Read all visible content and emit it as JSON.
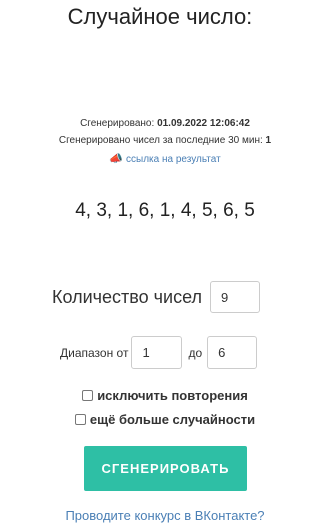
{
  "title": "Случайное число:",
  "meta": {
    "generated_label": "Сгенерировано:",
    "generated_value": "01.09.2022 12:06:42",
    "count_label": "Сгенерировано чисел за последние 30 мин:",
    "count_value": "1",
    "link_icon": "share-link-icon",
    "link_text": "ссылка на результат"
  },
  "result": "4, 3, 1, 6, 1, 4, 5, 6, 5",
  "form": {
    "quantity_label": "Количество чисел",
    "quantity_value": "9",
    "range_label": "Диапазон от",
    "range_from_value": "1",
    "range_to_label": "до",
    "range_to_value": "6",
    "exclude_repeats_label": "исключить повторения",
    "exclude_repeats_checked": false,
    "more_random_label": "ещё больше случайности",
    "more_random_checked": false,
    "generate_button": "СГЕНЕРИРОВАТЬ"
  },
  "promo_link": "Проводите конкурс в ВКонтакте?",
  "colors": {
    "accent": "#2ebfa5",
    "link": "#4a7fb5"
  }
}
